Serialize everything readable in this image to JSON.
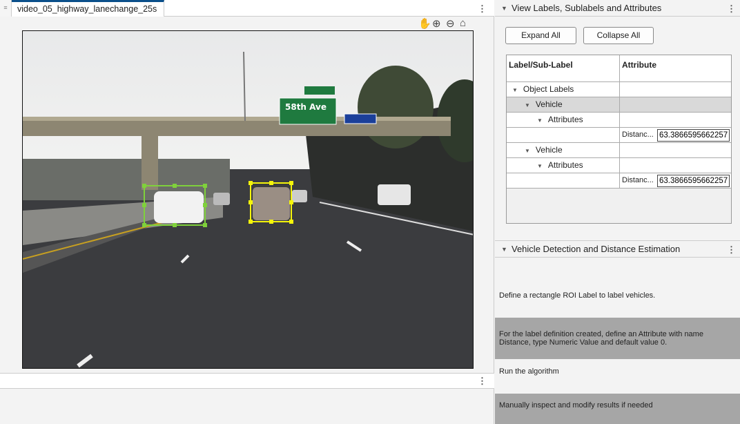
{
  "left_panel": {
    "tab_title": "video_05_highway_lanechange_25s"
  },
  "toolbar": {
    "icons": [
      "pan-hand-icon",
      "zoom-in-icon",
      "zoom-out-icon",
      "home-icon"
    ]
  },
  "right_panel": {
    "labels_section": {
      "title": "View Labels, Sublabels and Attributes",
      "expand_all": "Expand All",
      "collapse_all": "Collapse All",
      "columns": [
        "Label/Sub-Label",
        "Attribute"
      ],
      "tree": {
        "root": "Object Labels",
        "vehicle1": "Vehicle",
        "attributes1": "Attributes",
        "attr_name1": "Distanc...",
        "attr_value1": "63.3866595662257",
        "vehicle2": "Vehicle",
        "attributes2": "Attributes",
        "attr_name2": "Distanc...",
        "attr_value2": "63.3866595662257"
      }
    },
    "algo_section": {
      "title": "Vehicle Detection and Distance Estimation",
      "steps": [
        "Define a rectangle ROI Label to label vehicles.",
        "For the label definition created, define an Attribute with name Distance, type Numeric Value and default value 0.",
        "Run the algorithm",
        "Manually inspect and modify results if needed"
      ]
    }
  },
  "colors": {
    "accent": "#0b4f8a",
    "box_green": "#7fd13b",
    "box_yellow": "#f5f50a",
    "selected_row": "#d9d9d9",
    "step_gray": "#a6a6a6"
  }
}
